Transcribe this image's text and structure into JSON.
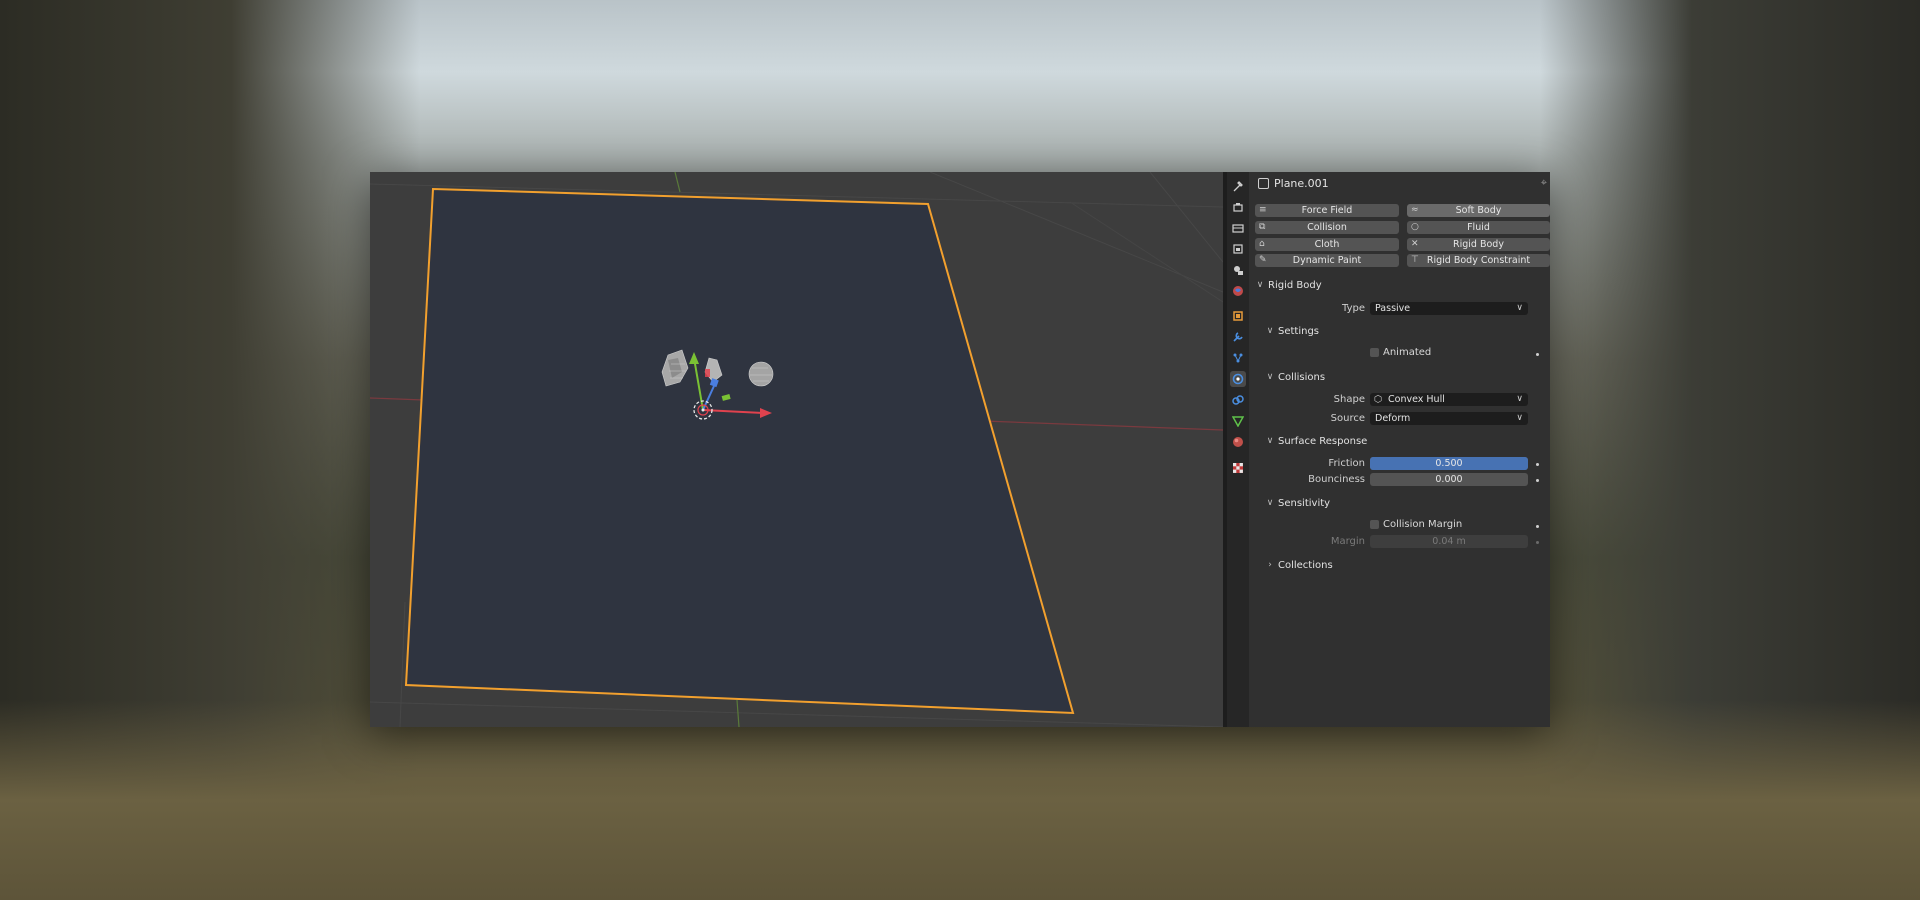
{
  "object": {
    "name": "Plane.001"
  },
  "physics_buttons": [
    {
      "label": "Force Field",
      "icon": "force-field-icon",
      "active": false
    },
    {
      "label": "Soft Body",
      "icon": "soft-body-icon",
      "active": true
    },
    {
      "label": "Collision",
      "icon": "collision-icon",
      "active": false
    },
    {
      "label": "Fluid",
      "icon": "fluid-icon",
      "active": false
    },
    {
      "label": "Cloth",
      "icon": "cloth-icon",
      "active": false
    },
    {
      "label": "Rigid Body",
      "icon": "close-icon",
      "active": false
    },
    {
      "label": "Dynamic Paint",
      "icon": "dynamic-paint-icon",
      "active": false
    },
    {
      "label": "Rigid Body Constraint",
      "icon": "constraint-icon",
      "active": false
    }
  ],
  "rigid_body": {
    "title": "Rigid Body",
    "type_label": "Type",
    "type_value": "Passive",
    "settings": {
      "title": "Settings",
      "animated_label": "Animated",
      "animated": false
    },
    "collisions": {
      "title": "Collisions",
      "shape_label": "Shape",
      "shape_value": "Convex Hull",
      "source_label": "Source",
      "source_value": "Deform"
    },
    "surface_response": {
      "title": "Surface Response",
      "friction_label": "Friction",
      "friction_value": "0.500",
      "friction_fraction": 1.0,
      "bounciness_label": "Bounciness",
      "bounciness_value": "0.000"
    },
    "sensitivity": {
      "title": "Sensitivity",
      "collision_margin_label": "Collision Margin",
      "collision_margin": false,
      "margin_label": "Margin",
      "margin_value": "0.04 m"
    },
    "collections": {
      "title": "Collections"
    }
  },
  "colors": {
    "selection_outline": "#f2a02e",
    "x_axis": "#e0424e",
    "y_axis": "#7ac234",
    "accent": "#4772b3"
  }
}
